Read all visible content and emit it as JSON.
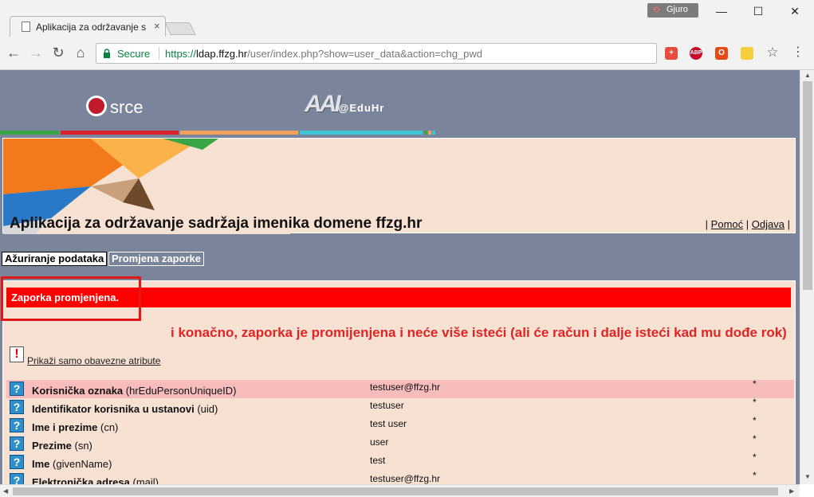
{
  "browser": {
    "tab_title": "Aplikacija za održavanje s",
    "tab_close": "×",
    "profile_name": "Gjuro",
    "secure_label": "Secure",
    "url_scheme": "https://",
    "url_host": "ldap.ffzg.hr",
    "url_path": "/user/index.php?show=user_data&action=chg_pwd",
    "extensions": [
      {
        "name": "plus",
        "label": "+",
        "color": "#e74c3c"
      },
      {
        "name": "abp",
        "label": "ABP",
        "color": "#c70d2c"
      },
      {
        "name": "office",
        "label": "O",
        "color": "#e64a19"
      },
      {
        "name": "note",
        "label": "",
        "color": "#f4d03f"
      }
    ]
  },
  "site": {
    "logo_srce": "srce",
    "logo_aai": "AAI",
    "logo_eduhr": "@EduHr",
    "app_title": "Aplikacija za održavanje sadržaja imenika domene ffzg.hr",
    "link_help": "Pomoć",
    "link_logout": "Odjava",
    "sep": "|"
  },
  "menu": {
    "update_data": "Ažuriranje podataka",
    "change_password": "Promjena zaporke"
  },
  "content": {
    "status_message": "Zaporka promjenjena.",
    "annotation": "i konačno, zaporka je promijenjena i neće više isteći (ali će račun i dalje isteći kad mu dođe rok)",
    "show_required_link": " Prikaži samo obavezne atribute",
    "rows": [
      {
        "label": "Korisnička oznaka",
        "attr": "(hrEduPersonUniqueID)",
        "value": "testuser@ffzg.hr",
        "star": "*"
      },
      {
        "label": "Identifikator korisnika u ustanovi",
        "attr": "(uid)",
        "value": "testuser",
        "star": "*"
      },
      {
        "label": "Ime i prezime",
        "attr": "(cn)",
        "value": "test user",
        "star": "*"
      },
      {
        "label": "Prezime",
        "attr": "(sn)",
        "value": "user",
        "star": "*"
      },
      {
        "label": "Ime",
        "attr": "(givenName)",
        "value": "test",
        "star": "*"
      },
      {
        "label": "Elektronička adresa",
        "attr": "(mail)",
        "value": "testuser@ffzg.hr",
        "star": "*"
      }
    ]
  },
  "colors": {
    "header_bg": "#7a849a",
    "page_bg": "#f7e1d2",
    "status_red": "#ff0000",
    "annotation_red": "#e02424",
    "row_highlight": "#f7bdbd"
  }
}
